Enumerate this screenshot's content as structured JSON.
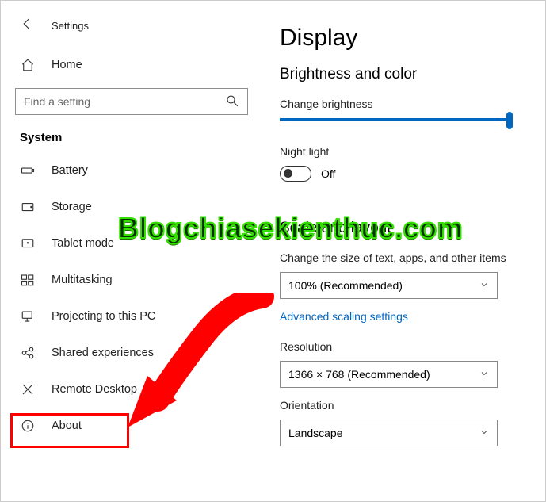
{
  "header": {
    "settings_label": "Settings",
    "home_label": "Home"
  },
  "search": {
    "placeholder": "Find a setting"
  },
  "sidebar": {
    "section_title": "System",
    "items": [
      {
        "label": "Battery"
      },
      {
        "label": "Storage"
      },
      {
        "label": "Tablet mode"
      },
      {
        "label": "Multitasking"
      },
      {
        "label": "Projecting to this PC"
      },
      {
        "label": "Shared experiences"
      },
      {
        "label": "Remote Desktop"
      },
      {
        "label": "About"
      }
    ]
  },
  "main": {
    "title": "Display",
    "brightness_heading": "Brightness and color",
    "change_brightness_label": "Change brightness",
    "night_light_label": "Night light",
    "night_light_value": "Off",
    "scale_heading": "Scale and layout",
    "scale_label": "Change the size of text, apps, and other items",
    "scale_value": "100% (Recommended)",
    "advanced_link": "Advanced scaling settings",
    "resolution_label": "Resolution",
    "resolution_value": "1366 × 768 (Recommended)",
    "orientation_label": "Orientation",
    "orientation_value": "Landscape"
  },
  "watermark": "Blogchiasekienthuc.com",
  "annotation": {
    "highlight_target": "About",
    "arrow_points_to": "About"
  }
}
